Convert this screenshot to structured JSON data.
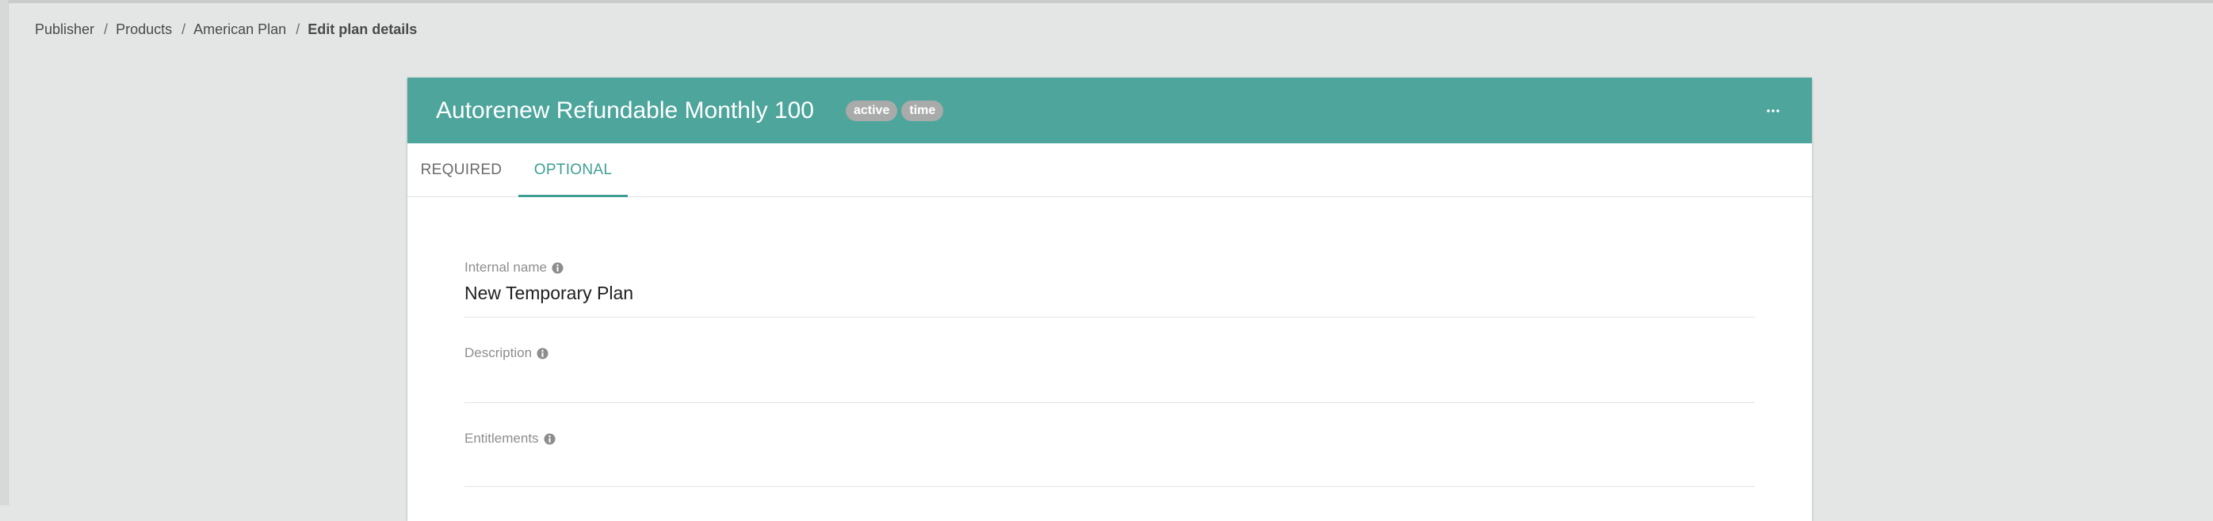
{
  "breadcrumb": {
    "items": [
      "Publisher",
      "Products",
      "American Plan"
    ],
    "current": "Edit plan details",
    "separator": "/"
  },
  "plan": {
    "title": "Autorenew Refundable Monthly 100",
    "badges": [
      "active",
      "time"
    ]
  },
  "header": {
    "more_icon": "more-horizontal-icon"
  },
  "tabs": [
    {
      "label": "REQUIRED",
      "active": false
    },
    {
      "label": "OPTIONAL",
      "active": true
    }
  ],
  "fields": {
    "internal_name": {
      "label": "Internal name",
      "value": "New Temporary Plan",
      "icon": "info-icon"
    },
    "description": {
      "label": "Description",
      "value": "",
      "icon": "info-icon"
    },
    "entitlements": {
      "label": "Entitlements",
      "value": "",
      "icon": "info-icon"
    }
  },
  "colors": {
    "header": "#4da59c",
    "accent": "#3f9e94",
    "badge": "#a9aaaa",
    "page_background": "#e4e6e5"
  }
}
